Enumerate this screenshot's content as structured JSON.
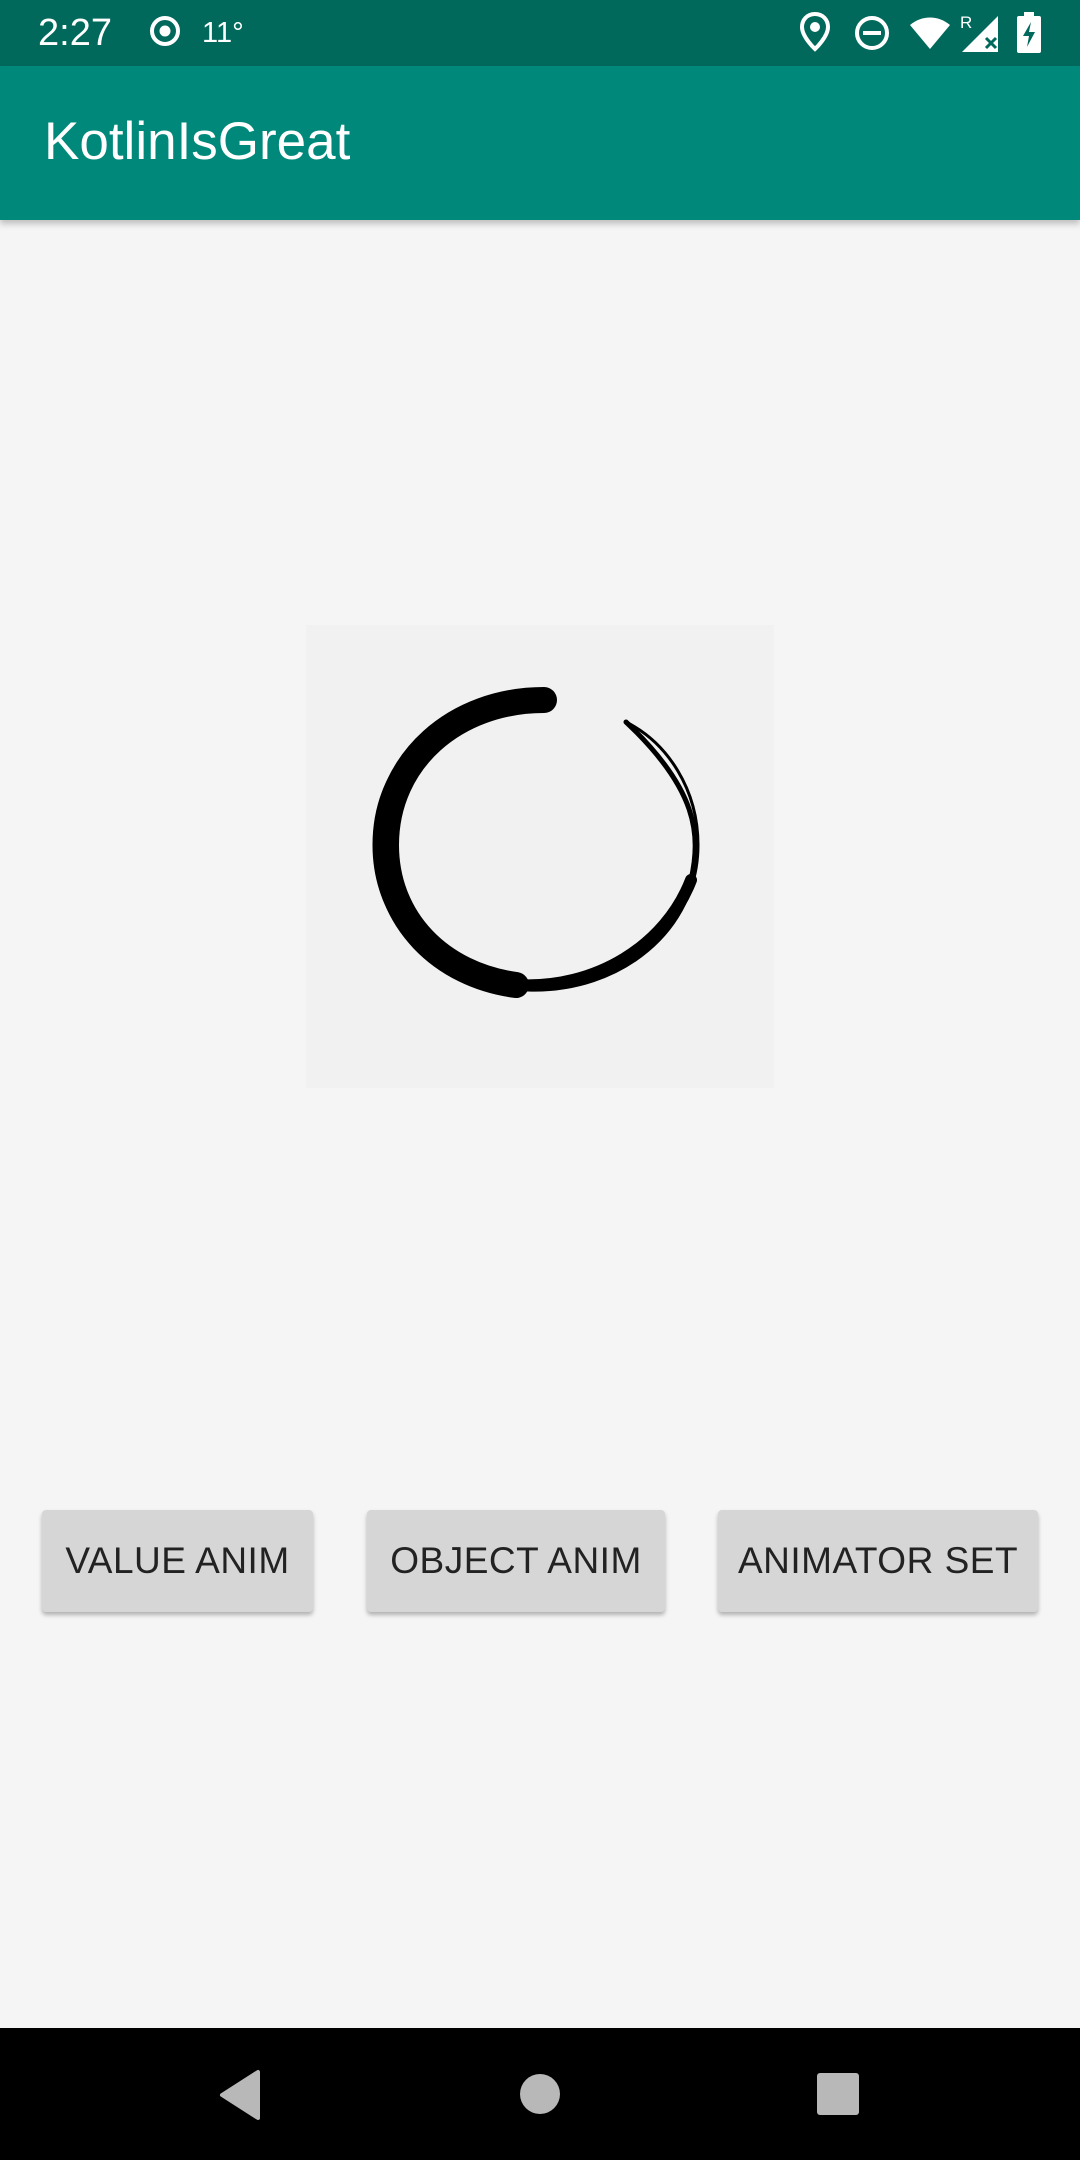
{
  "status_bar": {
    "time": "2:27",
    "temperature": "11°",
    "icons": [
      "sync-icon",
      "location-icon",
      "do-not-disturb-icon",
      "wifi-icon",
      "signal-icon",
      "battery-charging-icon"
    ],
    "signal_roaming_label": "R",
    "background_color": "#00695c"
  },
  "app_bar": {
    "title": "KotlinIsGreat",
    "background_color": "#00897b"
  },
  "animation": {
    "icon": "loading-ring-icon"
  },
  "buttons": {
    "value_anim": "VALUE ANIM",
    "object_anim": "OBJECT ANIM",
    "animator_set": "ANIMATOR SET"
  },
  "nav_bar": {
    "icons": [
      "back-icon",
      "home-icon",
      "recents-icon"
    ]
  }
}
